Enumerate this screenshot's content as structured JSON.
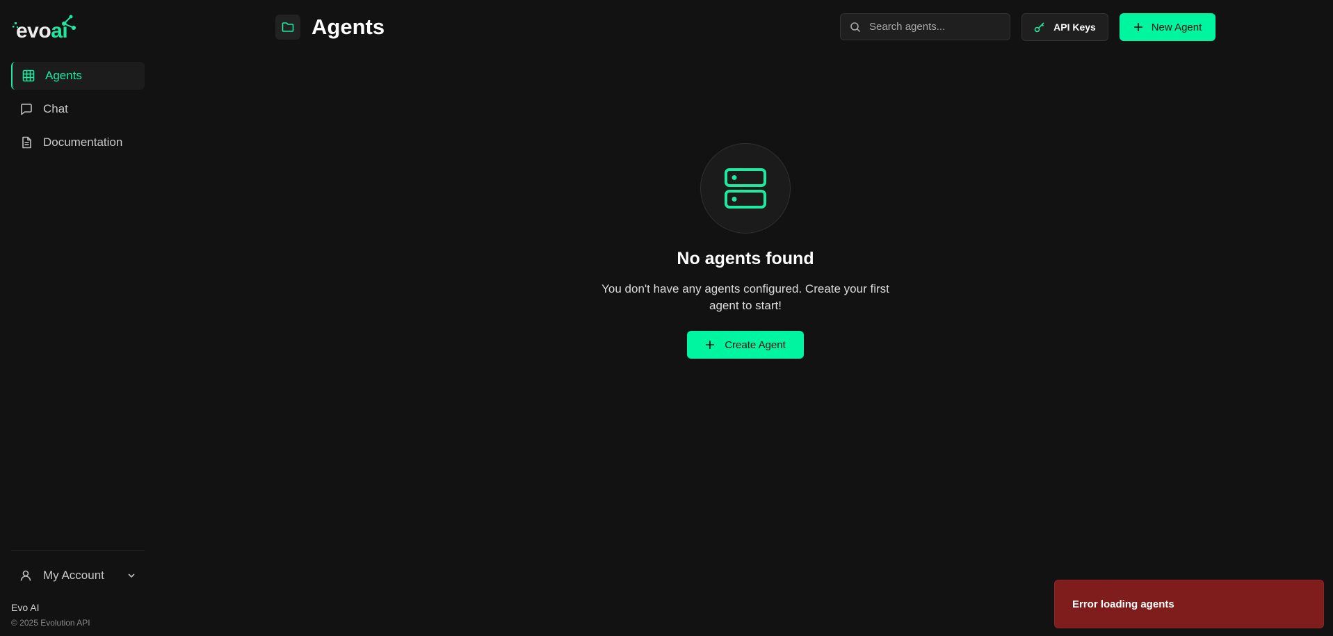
{
  "logo": {
    "evo": "evo",
    "ai": "ai"
  },
  "sidebar": {
    "items": [
      {
        "label": "Agents",
        "icon": "grid-icon",
        "active": true
      },
      {
        "label": "Chat",
        "icon": "chat-icon",
        "active": false
      },
      {
        "label": "Documentation",
        "icon": "file-text-icon",
        "active": false
      }
    ],
    "account_label": "My Account",
    "brand_name": "Evo AI",
    "copyright": "© 2025 Evolution API"
  },
  "header": {
    "title": "Agents",
    "search_placeholder": "Search agents...",
    "api_keys_label": "API Keys",
    "new_agent_label": "New Agent"
  },
  "empty_state": {
    "title": "No agents found",
    "description": "You don't have any agents configured. Create your first agent to start!",
    "create_label": "Create Agent"
  },
  "toast": {
    "message": "Error loading agents"
  },
  "colors": {
    "accent": "#00f5a0",
    "background": "#121212",
    "error": "#7f1d1d"
  }
}
